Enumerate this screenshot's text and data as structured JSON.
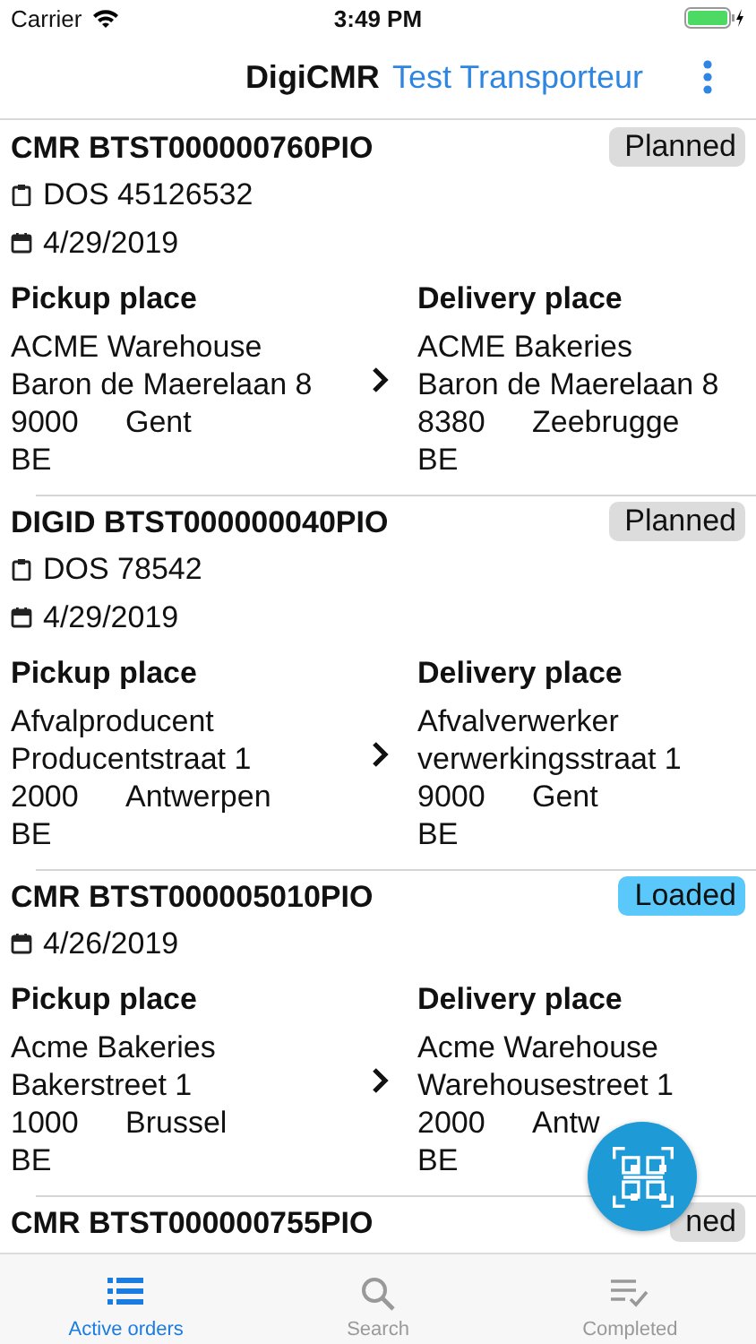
{
  "status_bar": {
    "carrier": "Carrier",
    "time": "3:49 PM"
  },
  "header": {
    "app_name": "DigiCMR",
    "account": "Test Transporteur"
  },
  "orders": [
    {
      "title": "CMR  BTST000000760PIO",
      "status": {
        "label": "Planned",
        "color": "#dcdcdc"
      },
      "dossier": "DOS 45126532",
      "date": "4/29/2019",
      "pickup": {
        "label": "Pickup place",
        "name": "ACME Warehouse",
        "street": "Baron de Maerelaan 8",
        "postal_code": "9000",
        "city": "Gent",
        "country": "BE"
      },
      "delivery": {
        "label": "Delivery place",
        "name": "ACME Bakeries",
        "street": "Baron de Maerelaan 8",
        "postal_code": "8380",
        "city": "Zeebrugge",
        "country": "BE"
      }
    },
    {
      "title": "DIGID  BTST000000040PIO",
      "status": {
        "label": "Planned",
        "color": "#dcdcdc"
      },
      "dossier": "DOS 78542",
      "date": "4/29/2019",
      "pickup": {
        "label": "Pickup place",
        "name": "Afvalproducent",
        "street": "Producentstraat 1",
        "postal_code": "2000",
        "city": "Antwerpen",
        "country": "BE"
      },
      "delivery": {
        "label": "Delivery place",
        "name": "Afvalverwerker",
        "street": "verwerkingsstraat 1",
        "postal_code": "9000",
        "city": "Gent",
        "country": "BE"
      }
    },
    {
      "title": "CMR  BTST000005010PIO",
      "status": {
        "label": "Loaded",
        "color": "#5ac8fa"
      },
      "date": "4/26/2019",
      "pickup": {
        "label": "Pickup place",
        "name": "Acme Bakeries",
        "street": "Bakerstreet 1",
        "postal_code": "1000",
        "city": "Brussel",
        "country": "BE"
      },
      "delivery": {
        "label": "Delivery place",
        "name": "Acme Warehouse",
        "street": "Warehousestreet 1",
        "postal_code": "2000",
        "city": "Antw",
        "country": "BE"
      }
    },
    {
      "title": "CMR  BTST000000755PIO",
      "status": {
        "label": "ned",
        "color": "#dcdcdc"
      }
    }
  ],
  "tabs": [
    {
      "kind": "list",
      "label": "Active orders",
      "selected": true
    },
    {
      "kind": "search",
      "label": "Search",
      "selected": false
    },
    {
      "kind": "done",
      "label": "Completed",
      "selected": false
    }
  ]
}
